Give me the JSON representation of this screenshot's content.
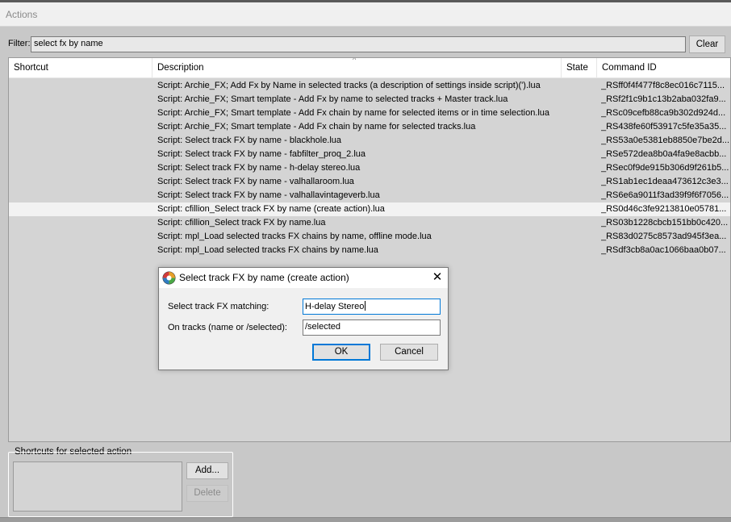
{
  "window": {
    "title": "Actions"
  },
  "filter": {
    "label": "Filter:",
    "value": "select fx by name",
    "clear_label": "Clear"
  },
  "columns": {
    "shortcut": "Shortcut",
    "description": "Description",
    "state": "State",
    "command_id": "Command ID"
  },
  "rows": [
    {
      "shortcut": "",
      "description": "Script: Archie_FX; Add Fx by Name in selected tracks (a description of settings inside script)(').lua",
      "state": "",
      "command_id": "_RSff0f4f477f8c8ec016c7115..."
    },
    {
      "shortcut": "",
      "description": "Script: Archie_FX; Smart template - Add Fx by name to selected tracks + Master track.lua",
      "state": "",
      "command_id": "_RSf2f1c9b1c13b2aba032fa9..."
    },
    {
      "shortcut": "",
      "description": "Script: Archie_FX; Smart template - Add Fx chain by name for selected items or in time selection.lua",
      "state": "",
      "command_id": "_RSc09cefb88ca9b302d924d..."
    },
    {
      "shortcut": "",
      "description": "Script: Archie_FX; Smart template - Add Fx chain by name for selected tracks.lua",
      "state": "",
      "command_id": "_RS438fe60f53917c5fe35a35..."
    },
    {
      "shortcut": "",
      "description": "Script: Select track FX by name - blackhole.lua",
      "state": "",
      "command_id": "_RS53a0e5381eb8850e7be2d..."
    },
    {
      "shortcut": "",
      "description": "Script: Select track FX by name - fabfilter_proq_2.lua",
      "state": "",
      "command_id": "_RSe572dea8b0a4fa9e8acbb..."
    },
    {
      "shortcut": "",
      "description": "Script: Select track FX by name - h-delay stereo.lua",
      "state": "",
      "command_id": "_RSec0f9de915b306d9f261b5..."
    },
    {
      "shortcut": "",
      "description": "Script: Select track FX by name - valhallaroom.lua",
      "state": "",
      "command_id": "_RS1ab1ec1deaa473612c3e3..."
    },
    {
      "shortcut": "",
      "description": "Script: Select track FX by name - valhallavintageverb.lua",
      "state": "",
      "command_id": "_RS6e6a9011f3ad39f9f6f7056..."
    },
    {
      "shortcut": "",
      "description": "Script: cfillion_Select track FX by name (create action).lua",
      "state": "",
      "command_id": "_RS0d46c3fe9213810e05781..."
    },
    {
      "shortcut": "",
      "description": "Script: cfillion_Select track FX by name.lua",
      "state": "",
      "command_id": "_RS03b1228cbcb151bb0c420..."
    },
    {
      "shortcut": "",
      "description": "Script: mpl_Load selected tracks FX chains by name, offline mode.lua",
      "state": "",
      "command_id": "_RS83d0275c8573ad945f3ea..."
    },
    {
      "shortcut": "",
      "description": "Script: mpl_Load selected tracks FX chains by name.lua",
      "state": "",
      "command_id": "_RSdf3cb8a0ac1066baa0b07..."
    }
  ],
  "selected_row_index": 9,
  "shortcuts_panel": {
    "label": "Shortcuts for selected action",
    "add_label": "Add...",
    "delete_label": "Delete"
  },
  "dialog": {
    "title": "Select track FX by name (create action)",
    "close_glyph": "✕",
    "fx_label": "Select track FX matching:",
    "fx_value": "H-delay Stereo",
    "tracks_label": "On tracks (name or /selected):",
    "tracks_value": "/selected",
    "ok_label": "OK",
    "cancel_label": "Cancel",
    "icon": "reaper-logo-icon"
  },
  "colors": {
    "selected_row": "#f2f2f2",
    "focus_border": "#0078d7",
    "list_bg": "#d4d4d4"
  }
}
